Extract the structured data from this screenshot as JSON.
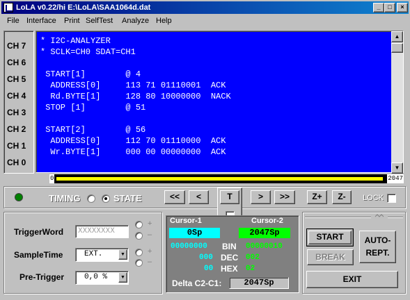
{
  "window": {
    "title": "LoLA v0.22/hi  E:\\LoLA\\SAA1064d.dat"
  },
  "title_buttons": {
    "minimize": "_",
    "maximize": "□",
    "close": "×"
  },
  "menu": [
    "File",
    "Interface",
    "Print",
    "SelfTest",
    "Analyze",
    "Help"
  ],
  "channels": [
    "CH 7",
    "CH 6",
    "CH 5",
    "CH 4",
    "CH 3",
    "CH 2",
    "CH 1",
    "CH 0"
  ],
  "output_lines": [
    "* I2C-ANALYZER",
    "* SCLK=CH0 SDAT=CH1",
    "",
    " START[1]        @ 4",
    "  ADDRESS[0]     113 71 01110001  ACK",
    "  Rd.BYTE[1]     128 80 10000000  NACK",
    " STOP [1]        @ 51",
    "",
    " START[2]        @ 56",
    "  ADDRESS[0]     112 70 01110000  ACK",
    "  Wr.BYTE[1]     000 00 00000000  ACK"
  ],
  "scroll": {
    "up": "▲",
    "down": "▼"
  },
  "position_bar": {
    "start": "0",
    "end": "2047"
  },
  "mode": {
    "timing": "TIMING",
    "state": "STATE",
    "selected": "state"
  },
  "nav_buttons": {
    "first": "<<",
    "prev": "<",
    "trigger": "T",
    "next": ">",
    "last": ">>",
    "zoom_in": "Z+",
    "zoom_out": "Z-"
  },
  "lock_label": "LOCK",
  "trigger_panel": {
    "trigger_word_label": "TriggerWord",
    "trigger_word_value": "XXXXXXXX",
    "sample_time_label": "SampleTime",
    "sample_time_value": "EXT.",
    "pre_trigger_label": "Pre-Trigger",
    "pre_trigger_value": "0,0 %",
    "plus": "+",
    "minus": "–"
  },
  "cursor_panel": {
    "cursor1_label": "Cursor-1",
    "cursor2_label": "Cursor-2",
    "cursor1_value": "0Sp",
    "cursor2_value": "2047Sp",
    "bin_label": "BIN",
    "dec_label": "DEC",
    "hex_label": "HEX",
    "c1_bin": "00000000",
    "c1_dec": "000",
    "c1_hex": "00",
    "c2_bin": "00000010",
    "c2_dec": "002",
    "c2_hex": "02",
    "delta_label": "Delta C2-C1:",
    "delta_value": "2047Sp",
    "colors": {
      "cursor1": "#00ffff",
      "cursor2": "#00ff00"
    }
  },
  "control_panel": {
    "start": "START",
    "break": "BREAK",
    "auto_rept_line1": "AUTO-",
    "auto_rept_line2": "REPT.",
    "exit": "EXIT"
  }
}
